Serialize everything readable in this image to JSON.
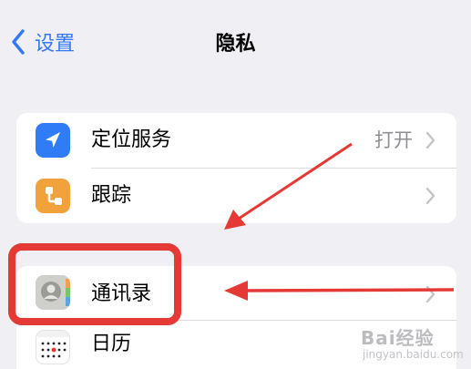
{
  "nav": {
    "back_label": "设置",
    "title": "隐私"
  },
  "settings": {
    "group1": [
      {
        "label": "定位服务",
        "value": "打开",
        "icon": "location-arrow-icon",
        "icon_color": "#2f7cf6"
      },
      {
        "label": "跟踪",
        "value": "",
        "icon": "tracking-icon",
        "icon_color": "#f2a23b"
      }
    ],
    "group2": [
      {
        "label": "通讯录",
        "icon": "contacts-icon",
        "icon_color": "#c9c9c5"
      },
      {
        "label": "日历",
        "icon": "calendar-icon",
        "icon_color": "#ffffff"
      }
    ]
  },
  "colors": {
    "accent": "#3478f6",
    "background": "#efeff4",
    "annotation_red": "#e53935"
  },
  "watermark": {
    "logo": "Bai经验",
    "sub": "jingyan.baidu.com"
  }
}
